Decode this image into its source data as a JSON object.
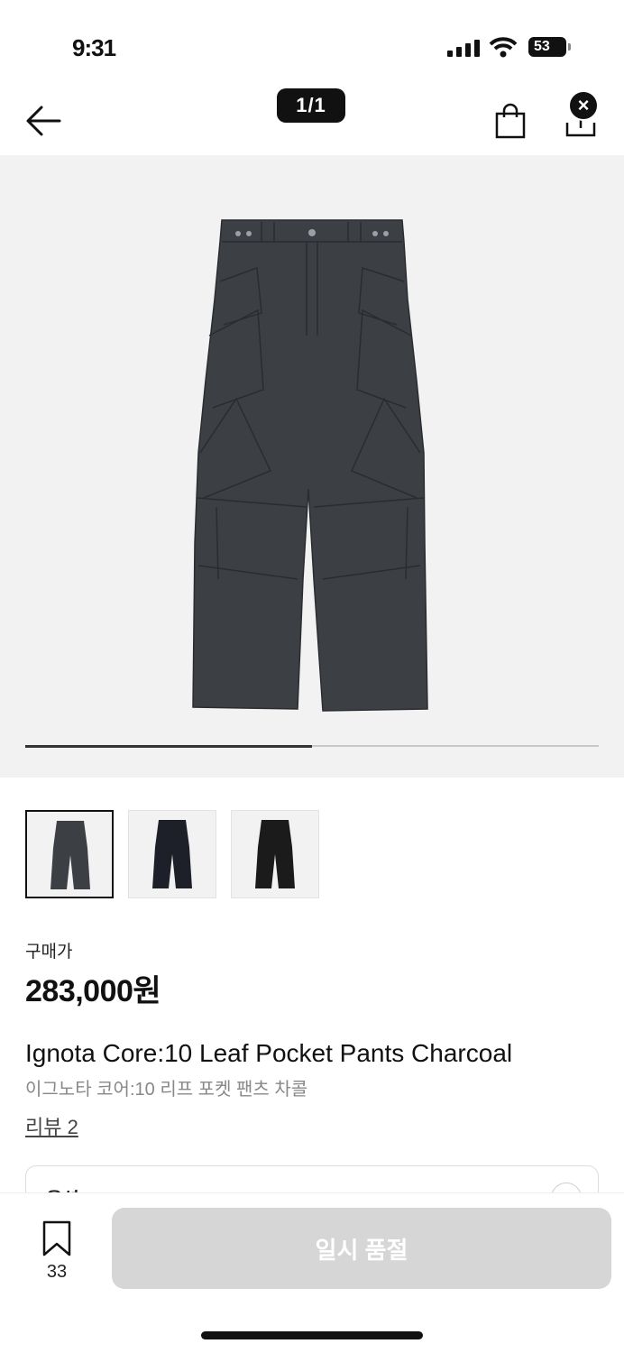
{
  "status_bar": {
    "time": "9:31",
    "battery": "53"
  },
  "header": {
    "page_indicator": "1/1",
    "close_symbol": "×"
  },
  "gallery": {
    "progress": 0.5
  },
  "thumbnails": [
    {
      "name": "charcoal",
      "color": "#3c3f44",
      "selected": true
    },
    {
      "name": "navy",
      "color": "#1e2029",
      "selected": false
    },
    {
      "name": "black",
      "color": "#1b1b1b",
      "selected": false
    }
  ],
  "product": {
    "price_label": "구매가",
    "price": "283,000원",
    "title_en": "Ignota Core:10 Leaf Pocket Pants Charcoal",
    "title_ko": "이그노타 코어:10 리프 포켓 팬츠 차콜",
    "review_link": "리뷰 2",
    "option_label": "옵션"
  },
  "bottom_bar": {
    "bookmark_count": "33",
    "soldout_label": "일시 품절"
  },
  "colors": {
    "accent": "#111111",
    "disabled": "#d6d6d6",
    "gallery_bg": "#f2f2f2",
    "pants": "#3c3f44"
  }
}
